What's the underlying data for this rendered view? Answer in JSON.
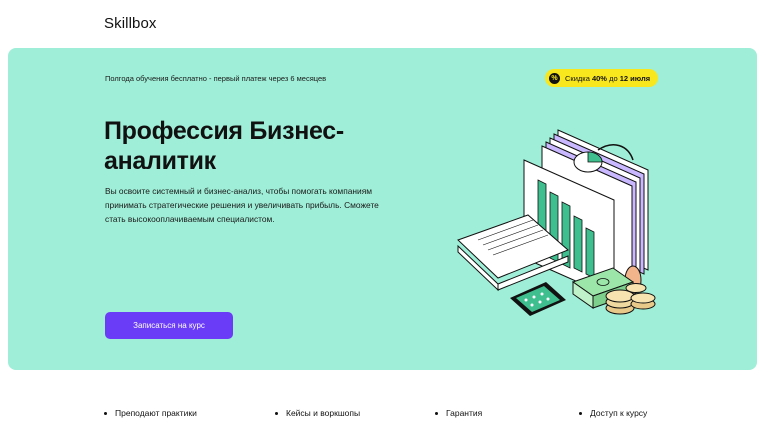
{
  "header": {
    "logo": "Skillbox"
  },
  "hero": {
    "note": "Полгода обучения бесплатно - первый платеж через 6 месяцев",
    "promo": {
      "icon": "percent-icon",
      "text_pre": "Скидка ",
      "text_bold": "40%",
      "text_mid": " до ",
      "text_date": "12 июля"
    },
    "title": "Профессия Бизнес-аналитик",
    "description": "Вы освоите системный и бизнес-анализ, чтобы помогать компаниям принимать стратегические решения и увеличивать прибыль. Сможете стать высокооплачиваемым специалистом.",
    "cta_label": "Записаться на курс",
    "background_color": "#9feed7",
    "cta_color": "#6a3cf7",
    "promo_color": "#f8e71c"
  },
  "features": [
    {
      "label": "Преподают практики"
    },
    {
      "label": "Кейсы и воркшопы"
    },
    {
      "label": "Гарантия"
    },
    {
      "label": "Доступ к курсу"
    }
  ]
}
